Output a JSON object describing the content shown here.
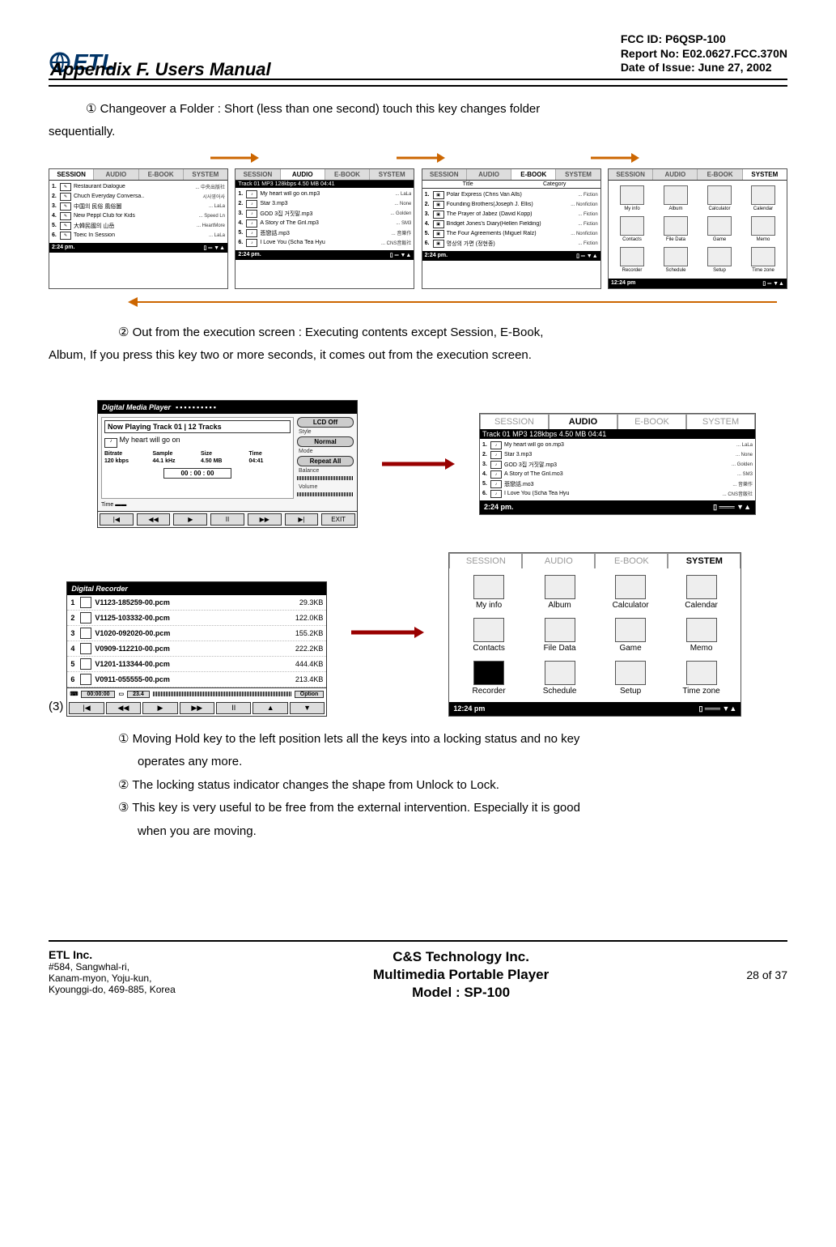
{
  "header": {
    "logo_text": "ETL",
    "appendix": "Appendix F.  Users Manual",
    "fcc_id": "FCC ID: P6QSP-100",
    "report_no": "Report No: E02.0627.FCC.370N",
    "date": "Date of Issue: June 27, 2002"
  },
  "para1_a": "①  Changeover a Folder  : Short (less than one second) touch this key changes folder",
  "para1_b": "sequentially.",
  "tabs": [
    "SESSION",
    "AUDIO",
    "E-BOOK",
    "SYSTEM"
  ],
  "screen1": {
    "items": [
      {
        "n": "1.",
        "t": "Restaurant Dialogue",
        "r": "... 中央出版社"
      },
      {
        "n": "2.",
        "t": "Chuch Everyday Conversa..",
        "r": "시사영어사"
      },
      {
        "n": "3.",
        "t": "中国의 民俗 風俗圖",
        "r": "... LaLa"
      },
      {
        "n": "4.",
        "t": "New Peppl Club for Kids",
        "r": "... Speed Ln"
      },
      {
        "n": "5.",
        "t": "大韓民國의 山岳",
        "r": "... HeartMore"
      },
      {
        "n": "6.",
        "t": "Toeic In Session",
        "r": "... LaLa"
      }
    ],
    "status": "2:24 pm."
  },
  "screen2": {
    "topbar": "Track 01   MP3   128kbps   4.50 MB  04:41",
    "items": [
      {
        "n": "1.",
        "t": "My heart will go on.mp3",
        "r": "... LaLa"
      },
      {
        "n": "2.",
        "t": "Star 3.mp3",
        "r": "... None"
      },
      {
        "n": "3.",
        "t": "GOD 3집 거짓말.mp3",
        "r": "... Golden"
      },
      {
        "n": "4.",
        "t": "A Story of The Gril.mp3",
        "r": "... SM3"
      },
      {
        "n": "5.",
        "t": "悲戀話.mp3",
        "r": "... 音樂作"
      },
      {
        "n": "6.",
        "t": "I Love You (Scha Tea Hyu",
        "r": "... CNS音飯社"
      }
    ],
    "status": "2:24 pm."
  },
  "screen3": {
    "hdr_l": "Title",
    "hdr_r": "Category",
    "items": [
      {
        "n": "1.",
        "t": "Polar Express (Chris Van Alls)",
        "r": "... Fiction"
      },
      {
        "n": "2.",
        "t": "Founding Brothers(Joseph J. Ellis)",
        "r": "... Nonfiction"
      },
      {
        "n": "3.",
        "t": "The Prayer of Jabez (David Kopp)",
        "r": "... Fiction"
      },
      {
        "n": "4.",
        "t": "Bridget Jones's Diary(Hellen Fielding)",
        "r": "... Fiction"
      },
      {
        "n": "5.",
        "t": "The Four Agreements (Miguel Ralz)",
        "r": "... Nonfiction"
      },
      {
        "n": "6.",
        "t": "명상의 가면 (정현종)",
        "r": "... Fiction"
      }
    ],
    "status": "2:24 pm."
  },
  "screen4": {
    "items": [
      "My info",
      "Album",
      "Calculator",
      "Calendar",
      "Contacts",
      "File Data",
      "Game",
      "Memo",
      "Recorder",
      "Schedule",
      "Setup",
      "Time zone"
    ],
    "status": "12:24 pm"
  },
  "para2_a": "②  Out from the execution screen : Executing contents except Session, E-Book,",
  "para2_b": "Album, If you press this key two or more seconds, it comes out from the execution screen.",
  "player": {
    "title": "Digital Media Player",
    "nowplaying": "Now Playing Track 01 | 12  Tracks",
    "song": "My heart will go on",
    "labels": [
      "Bitrate",
      "Sample",
      "Size",
      "Time"
    ],
    "values": [
      "120 kbps",
      "44.1 kHz",
      "4.50 MB",
      "04:41"
    ],
    "timebox": "00 : 00 : 00",
    "right": {
      "lcd": "LCD Off",
      "style": "Style",
      "normal": "Normal",
      "mode": "Mode",
      "repeat": "Repeat All",
      "balance": "Balance",
      "volume": "Volume"
    },
    "ctrls": [
      "|◀",
      "◀◀",
      "▶",
      "II",
      "▶▶",
      "▶|",
      "EXIT"
    ],
    "time_lbl": "Time"
  },
  "audio_large": {
    "topbar": "Track 01   MP3   128kbps   4.50 MB  04:41",
    "items": [
      {
        "n": "1.",
        "t": "My heart will go on.mp3",
        "r": "... LaLa"
      },
      {
        "n": "2.",
        "t": "Star 3.mp3",
        "r": "... None"
      },
      {
        "n": "3.",
        "t": "GOD 3집 거짓말.mp3",
        "r": "... Golden"
      },
      {
        "n": "4.",
        "t": "A Story of The Gril.mo3",
        "r": "... SM3"
      },
      {
        "n": "5.",
        "t": "悲戀話.mo3",
        "r": "... 音樂作"
      },
      {
        "n": "6.",
        "t": "I Love You (Scha Tea Hyu",
        "r": "... CNS音飯社"
      }
    ],
    "status": "2:24 pm."
  },
  "recorder": {
    "title": "Digital Recorder",
    "items": [
      {
        "n": "1",
        "name": "V1123-185259-00.pcm",
        "size": "29.3KB"
      },
      {
        "n": "2",
        "name": "V1125-103332-00.pcm",
        "size": "122.0KB"
      },
      {
        "n": "3",
        "name": "V1020-092020-00.pcm",
        "size": "155.2KB"
      },
      {
        "n": "4",
        "name": "V0909-112210-00.pcm",
        "size": "222.2KB"
      },
      {
        "n": "5",
        "name": "V1201-113344-00.pcm",
        "size": "444.4KB"
      },
      {
        "n": "6",
        "name": "V0911-055555-00.pcm",
        "size": "213.4KB"
      }
    ],
    "time": "00:00:00",
    "batt": "23.4",
    "option": "Option",
    "ctrls": [
      "|◀",
      "◀◀",
      "▶",
      "▶▶",
      "II",
      "▲",
      "▼"
    ]
  },
  "sys_large": {
    "tabs": [
      "SESSION",
      "AUDIO",
      "E-BOOK",
      "SYSTEM"
    ],
    "items": [
      "My info",
      "Album",
      "Calculator",
      "Calendar",
      "Contacts",
      "File Data",
      "Game",
      "Memo",
      "Recorder",
      "Schedule",
      "Setup",
      "Time zone"
    ],
    "status": "12:24 pm"
  },
  "paren3": "(3)",
  "bullets3": {
    "b1a": "① Moving Hold key to the left position lets all the keys into a locking status and no key",
    "b1b": "operates any more.",
    "b2": "② The locking status indicator changes the shape from Unlock to Lock.",
    "b3a": "③ This key is very useful to be free from the external intervention. Especially it is good",
    "b3b": "when you are moving."
  },
  "footer": {
    "left_company": "ETL Inc.",
    "left_addr1": "#584, Sangwhal-ri,",
    "left_addr2": "Kanam-myon, Yoju-kun,",
    "left_addr3": "Kyounggi-do, 469-885, Korea",
    "center1": "C&S Technology Inc.",
    "center2": "Multimedia Portable Player",
    "center3": "Model : SP-100",
    "right": "28 of 37"
  }
}
